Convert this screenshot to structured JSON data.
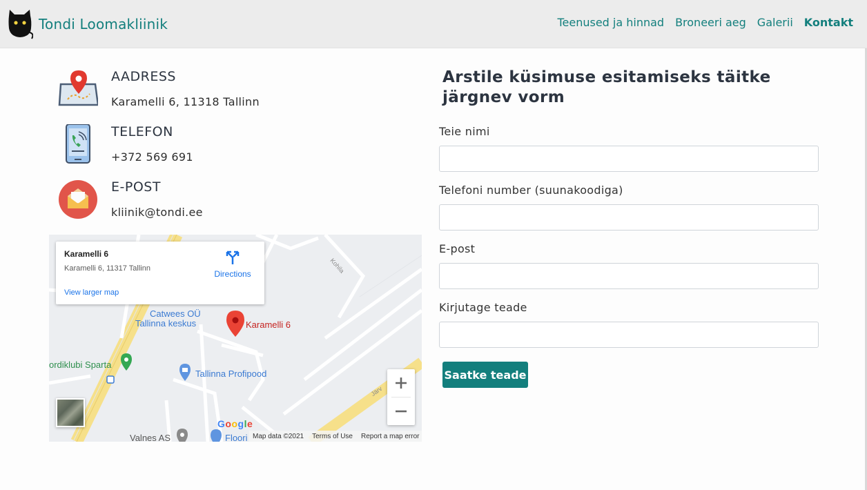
{
  "brand": {
    "name": "Tondi Loomakliinik"
  },
  "nav": {
    "items": [
      {
        "label": "Teenused ja hinnad"
      },
      {
        "label": "Broneeri aeg"
      },
      {
        "label": "Galerii"
      },
      {
        "label": "Kontakt"
      }
    ],
    "active": "Kontakt"
  },
  "contact": {
    "address": {
      "title": "AADRESS",
      "value": "Karamelli 6, 11318 Tallinn",
      "icon": "map-pin-icon"
    },
    "phone": {
      "title": "TELEFON",
      "value": "+372 569 691",
      "icon": "phone-icon"
    },
    "email": {
      "title": "E-POST",
      "value": "kliinik@tondi.ee",
      "icon": "mail-icon"
    }
  },
  "map": {
    "card": {
      "place": "Karamelli 6",
      "address": "Karamelli 6, 11317 Tallinn",
      "directions": "Directions",
      "view_larger": "View larger map"
    },
    "labels": {
      "catwees": "Catwees OÜ",
      "tallinna_keskus": "Tallinna keskus",
      "pin": "Karamelli 6",
      "sparta": "ordiklubi Sparta",
      "profipood": "Tallinna Profipood",
      "valnes": "Valnes AS",
      "floor": "Floori",
      "kohila": "Kohila",
      "jarvevana": "Järv"
    },
    "google": "Google",
    "attribution": {
      "map_data": "Map data ©2021",
      "terms": "Terms of Use",
      "report": "Report a map error"
    },
    "zoom_in": "+",
    "zoom_out": "−"
  },
  "form": {
    "title": "Arstile küsimuse esitamiseks täitke järgnev vorm",
    "fields": [
      {
        "label": "Teie nimi",
        "value": ""
      },
      {
        "label": "Telefoni number (suunakoodiga)",
        "value": ""
      },
      {
        "label": "E-post",
        "value": ""
      },
      {
        "label": "Kirjutage teade",
        "value": ""
      }
    ],
    "submit": "Saatke teade"
  },
  "colors": {
    "accent": "#137f7d",
    "navbar_bg": "#ececec"
  }
}
